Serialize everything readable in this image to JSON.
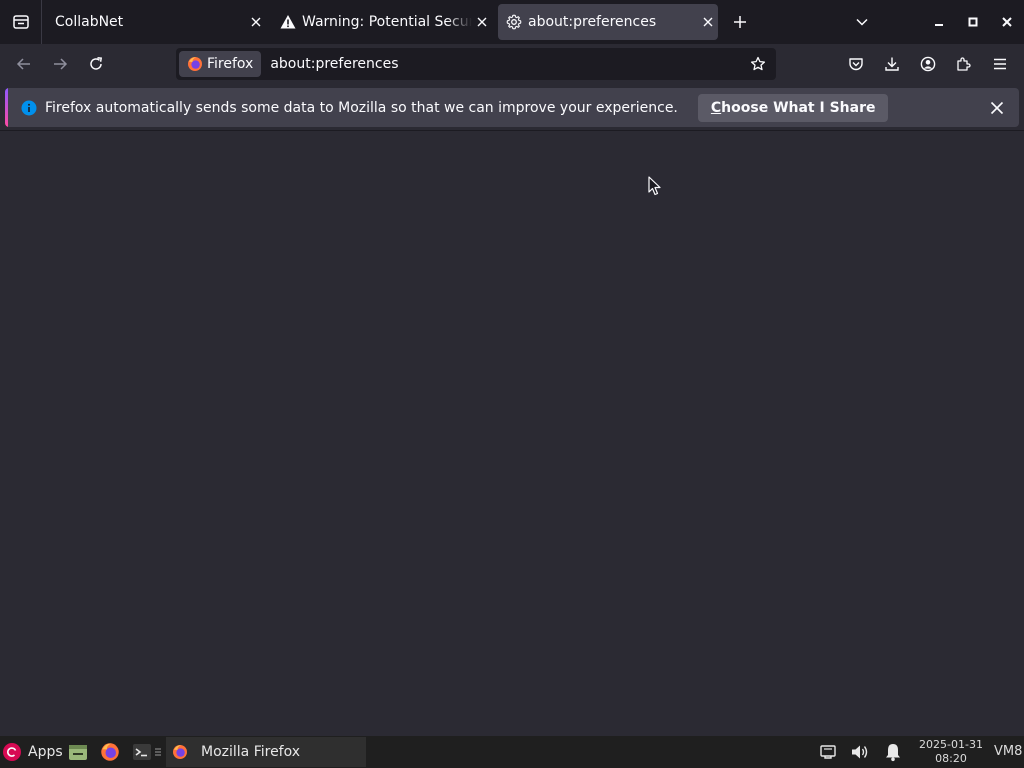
{
  "tabs": [
    {
      "label": "CollabNet",
      "active": false
    },
    {
      "label": "Warning: Potential Security Risk Ahead",
      "active": false
    },
    {
      "label": "about:preferences",
      "active": true
    }
  ],
  "navbar": {
    "identity_label": "Firefox",
    "url": "about:preferences"
  },
  "notification": {
    "message": "Firefox automatically sends some data to Mozilla so that we can improve your experience.",
    "button_first_letter": "C",
    "button_rest": "hoose What I Share"
  },
  "taskbar": {
    "apps_label": "Apps",
    "task_label": "Mozilla Firefox",
    "clock_date": "2025-01-31",
    "clock_time": "08:20",
    "user_label": "VM8"
  },
  "icons": {
    "tab_list": "tab-list-icon",
    "warning": "warning-icon",
    "gear": "gear-icon",
    "close": "close-icon",
    "new_tab": "plus-icon",
    "chevron": "chevron-down-icon",
    "back": "back-arrow-icon",
    "forward": "forward-arrow-icon",
    "reload": "reload-icon",
    "star": "star-icon",
    "pocket": "pocket-icon",
    "download": "download-icon",
    "account": "account-icon",
    "extensions": "puzzle-icon",
    "menu": "hamburger-icon",
    "info": "info-icon"
  },
  "colors": {
    "toolbar": "#2b2a33",
    "tabstrip": "#1c1b22",
    "selected_tab": "#42414d",
    "info_blue": "#0090ed",
    "accent_gradient_start": "#9059ff",
    "accent_gradient_end": "#ff4aa2"
  }
}
